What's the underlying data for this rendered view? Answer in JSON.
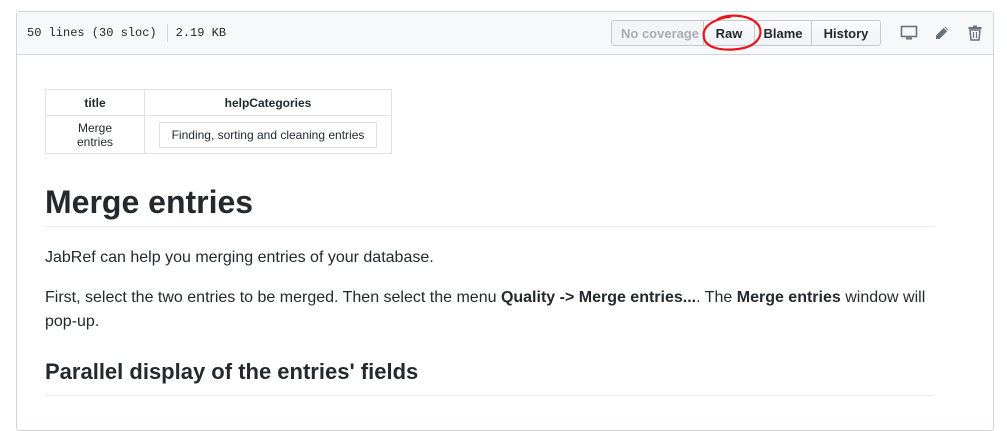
{
  "file_header": {
    "lines": "50 lines (30 sloc)",
    "size": "2.19 KB",
    "buttons": {
      "coverage": "No coverage",
      "raw": "Raw",
      "blame": "Blame",
      "history": "History"
    },
    "icons": [
      "desktop-icon",
      "pencil-icon",
      "trash-icon"
    ]
  },
  "metadata_table": {
    "headers": [
      "title",
      "helpCategories"
    ],
    "row": [
      "Merge entries",
      "Finding, sorting and cleaning entries"
    ]
  },
  "article": {
    "heading": "Merge entries",
    "para1": "JabRef can help you merging entries of your database.",
    "para2": {
      "t1": "First, select the two entries to be merged. Then select the menu ",
      "b1": "Quality -> Merge entries...",
      "t2": ". The ",
      "b2": "Merge entries",
      "t3": " window will pop-up."
    },
    "subheading": "Parallel display of the entries' fields"
  },
  "colors": {
    "annotation": "#e8141b",
    "border": "#d1d5da"
  }
}
